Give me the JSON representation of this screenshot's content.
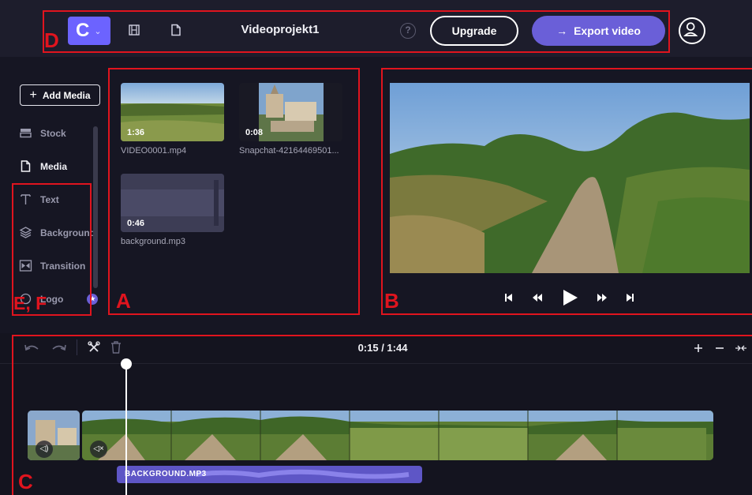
{
  "topbar": {
    "logo_letter": "C",
    "project_title": "Videoprojekt1",
    "help_glyph": "?",
    "upgrade_label": "Upgrade",
    "export_label": "Export video"
  },
  "sidebar": {
    "add_media_label": "Add Media",
    "items": [
      {
        "label": "Stock",
        "icon": "stock-icon"
      },
      {
        "label": "Media",
        "icon": "media-file-icon",
        "active": true
      },
      {
        "label": "Text",
        "icon": "text-icon"
      },
      {
        "label": "Background",
        "icon": "background-layers-icon"
      },
      {
        "label": "Transition",
        "icon": "transition-icon"
      },
      {
        "label": "Logo",
        "icon": "logo-icon",
        "badge": "★"
      }
    ]
  },
  "media": [
    {
      "duration": "1:36",
      "filename": "VIDEO0001.mp4"
    },
    {
      "duration": "0:08",
      "filename": "Snapchat-42164469501..."
    },
    {
      "duration": "0:46",
      "filename": "background.mp3"
    }
  ],
  "timeline": {
    "time_display": "0:15 / 1:44",
    "audio_clip_label": "BACKGROUND.MP3",
    "mute_glyph_1": "◁)",
    "mute_glyph_2": "◁×"
  },
  "annotations": {
    "A": "A",
    "B": "B",
    "C": "C",
    "D": "D",
    "EF": "E, F"
  },
  "colors": {
    "accent": "#6a5fd8",
    "annotation": "#e0141e",
    "background": "#161623"
  }
}
